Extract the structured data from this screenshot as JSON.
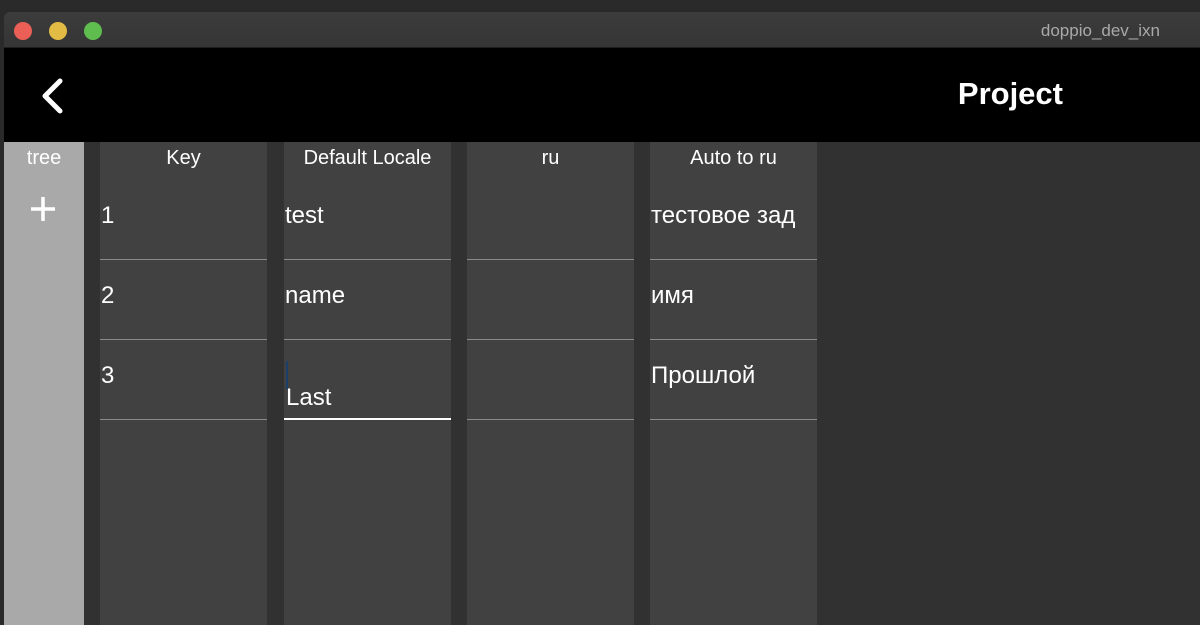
{
  "window": {
    "title": "doppio_dev_ixn"
  },
  "appbar": {
    "title": "Project"
  },
  "tree": {
    "label": "tree"
  },
  "columns": [
    {
      "header": "Key",
      "cells": [
        "1",
        "2",
        "3"
      ]
    },
    {
      "header": "Default Locale",
      "cells": [
        "test",
        "name",
        "Last"
      ]
    },
    {
      "header": "ru",
      "cells": [
        "",
        "",
        ""
      ]
    },
    {
      "header": "Auto to ru",
      "cells": [
        "тестовое зад",
        "имя",
        "Прошлой"
      ]
    }
  ],
  "colors": {
    "tree_bg": "#a9a9a9",
    "column_bg": "#414141",
    "appbar_bg": "#000000"
  },
  "icons": {
    "back": "chevron-left-icon",
    "add": "plus-icon"
  }
}
